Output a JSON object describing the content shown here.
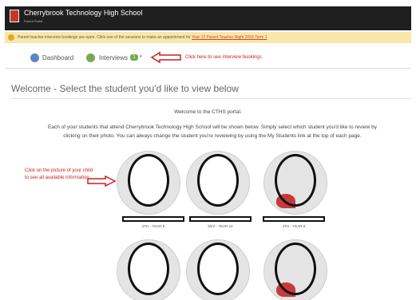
{
  "header": {
    "school_name": "Cherrybrook Technology High School",
    "portal_sub": "Parent Portal"
  },
  "notice": {
    "text": "Parent teacher interview bookings are open. Click one of the sessions to make an appointment for ",
    "link": "Year 12 Parent Teacher Night 2016 Term 1"
  },
  "nav": {
    "dashboard": "Dashboard",
    "interviews": "Interviews",
    "interviews_badge": "1",
    "annotation": "Click here to see interview bookings"
  },
  "main": {
    "title": "Welcome - Select the student you'd like to view below",
    "portal_line": "Welcome to the CTHS portal.",
    "intro_line1": "Each of your students that attend Cherrybrook Technology High School will be shown below. Simply select which student you'd like to review by",
    "intro_line2": "clicking on their photo. You can always change the student you're reviewing by using the My Students link at the top of each page.",
    "annotation": "Click on the picture of your child to see all available information"
  },
  "students": [
    {
      "year": "4TH - YEAR 8"
    },
    {
      "year": "5/I/2 - YEAR 10"
    },
    {
      "year": "4TH - YEAR 8"
    },
    {
      "year": ""
    },
    {
      "year": ""
    },
    {
      "year": ""
    }
  ],
  "colors": {
    "header_bg": "#1f1f1f",
    "notice_bg": "#f8e7a8",
    "annotation_red": "#cc1f1f",
    "badge_green": "#6cae44"
  },
  "icons": [
    "school-logo-icon",
    "info-icon",
    "dashboard-icon",
    "interviews-icon",
    "chevron-down-icon",
    "arrow-left-icon"
  ]
}
